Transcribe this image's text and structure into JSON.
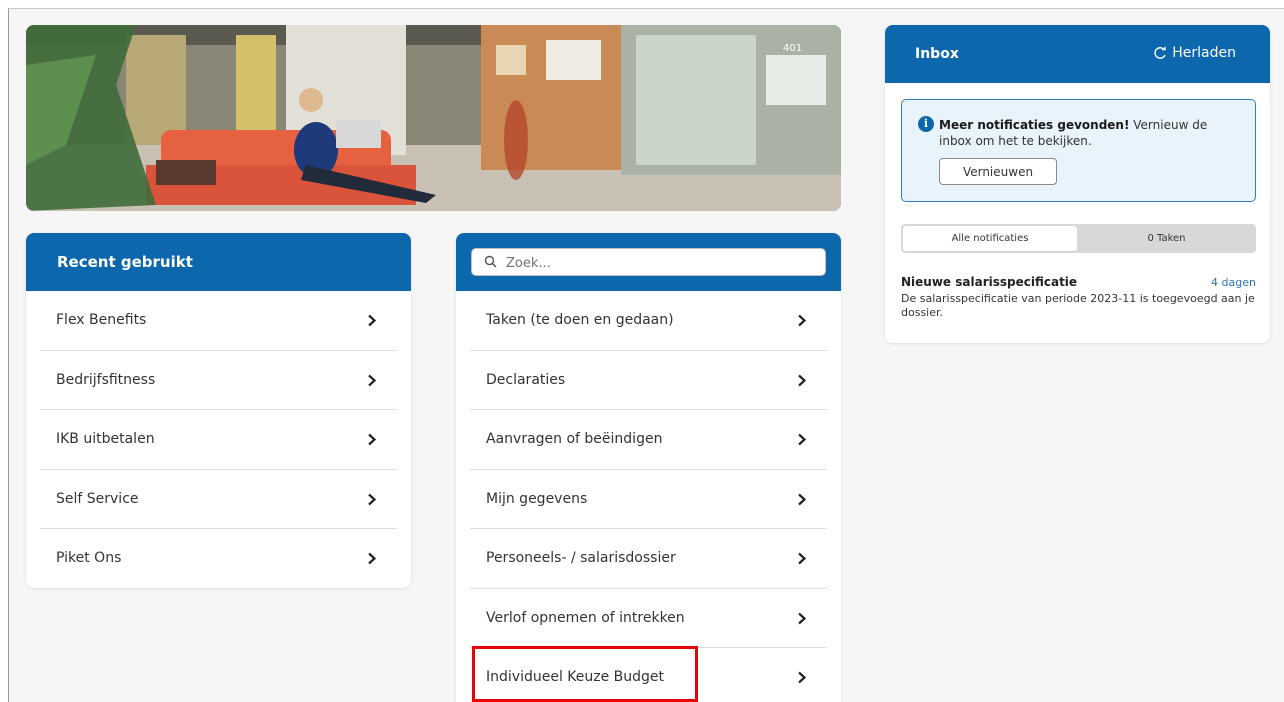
{
  "recent": {
    "title": "Recent gebruikt",
    "items": [
      {
        "label": "Flex Benefits"
      },
      {
        "label": "Bedrijfsfitness"
      },
      {
        "label": "IKB uitbetalen"
      },
      {
        "label": "Self Service"
      },
      {
        "label": "Piket Ons"
      }
    ]
  },
  "menu": {
    "search_placeholder": "Zoek...",
    "items": [
      {
        "label": "Taken (te doen en gedaan)"
      },
      {
        "label": "Declaraties"
      },
      {
        "label": "Aanvragen of beëindigen"
      },
      {
        "label": "Mijn gegevens"
      },
      {
        "label": "Personeels- / salarisdossier"
      },
      {
        "label": "Verlof opnemen of intrekken"
      },
      {
        "label": "Individueel Keuze Budget"
      }
    ]
  },
  "hero": {
    "room_number": "401"
  },
  "inbox": {
    "title": "Inbox",
    "reload_label": "Herladen",
    "notice_bold": "Meer notificaties gevonden!",
    "notice_text": " Vernieuw de inbox om het te bekijken.",
    "refresh_button": "Vernieuwen",
    "tabs": {
      "all": "Alle notificaties",
      "tasks": "0 Taken"
    },
    "notification": {
      "title": "Nieuwe salarisspecificatie",
      "age": "4 dagen",
      "body": "De salarisspecificatie van periode 2023-11 is toegevoegd aan je dossier."
    }
  },
  "colors": {
    "brand_blue": "#0d67ad",
    "highlight_red": "#e8000b",
    "notice_bg": "#e9f3fb"
  }
}
